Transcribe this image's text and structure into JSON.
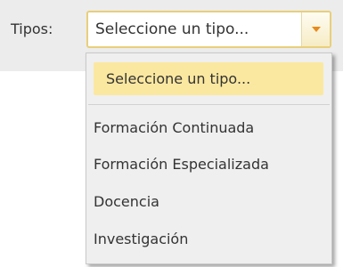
{
  "filter": {
    "label": "Tipos:",
    "selected_value": "Seleccione un tipo...",
    "dropdown_icon": "chevron-down-icon",
    "accent_color": "#e8891b",
    "highlight_color": "#fbe8a0"
  },
  "dropdown": {
    "options": [
      "Seleccione un tipo...",
      "Formación Continuada",
      "Formación Especializada",
      "Docencia",
      "Investigación"
    ],
    "highlighted_option": "Seleccione un tipo..."
  }
}
